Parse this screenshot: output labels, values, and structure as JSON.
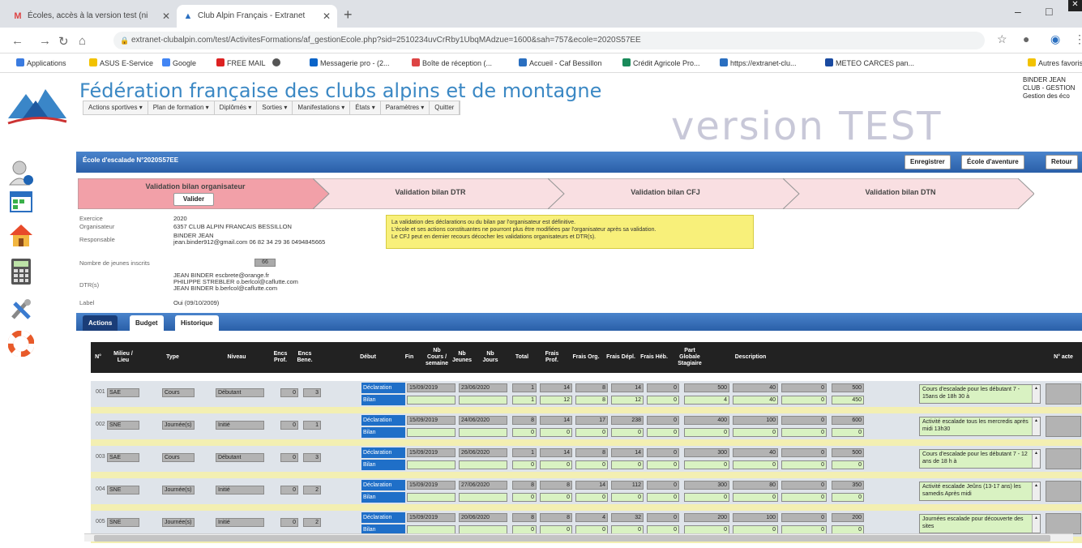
{
  "browser": {
    "tabs": [
      {
        "title": "Écoles, accès à la version test (ni",
        "icon": "gmail-icon"
      },
      {
        "title": "Club Alpin Français - Extranet",
        "icon": "caf-icon"
      }
    ],
    "url": "extranet-clubalpin.com/test/ActivitesFormations/af_gestionEcole.php?sid=2510234uvCrRby1UbqMAdzue=1600&sah=757&ecole=2020S57EE",
    "bookmarks": [
      "Applications",
      "ASUS E-Service",
      "Google",
      "FREE MAIL",
      "",
      "Messagerie pro - (2...",
      "Boîte de réception (...",
      "Accueil - Caf Bessillon",
      "Crédit Agricole Pro...",
      "https://extranet-clu...",
      "METEO CARCES pan..."
    ],
    "bookmarks_other": "Autres favoris"
  },
  "header": {
    "title": "Fédération française des clubs alpins et de montagne",
    "menu": [
      "Actions sportives ▾",
      "Plan de formation ▾",
      "Diplômés ▾",
      "Sorties ▾",
      "Manifestations ▾",
      "États ▾",
      "Paramètres ▾",
      "Quitter"
    ],
    "version": "version TEST",
    "user": [
      "BINDER JEAN",
      "CLUB - GESTION",
      "Gestion des éco"
    ]
  },
  "sidebar": [
    "user-icon",
    "calendar-icon",
    "home-icon",
    "calculator-icon",
    "tools-icon",
    "lifebuoy-icon"
  ],
  "panel": {
    "title": "École d'escalade N°2020S57EE",
    "buttons": [
      "Enregistrer",
      "École d'aventure",
      "Retour"
    ]
  },
  "steps": [
    {
      "label": "Validation bilan organisateur",
      "button": "Valider",
      "color": "#f2a0a8"
    },
    {
      "label": "Validation bilan DTR",
      "color": "#f9dfe2"
    },
    {
      "label": "Validation bilan CFJ",
      "color": "#f9dfe2"
    },
    {
      "label": "Validation bilan DTN",
      "color": "#f9dfe2"
    }
  ],
  "info": {
    "exercice_label": "Exercice",
    "exercice": "2020",
    "organisateur_label": "Organisateur",
    "organisateur": "6357 CLUB ALPIN FRANCAIS BESSILLON",
    "responsable_label": "Responsable",
    "responsable_name": "BINDER JEAN",
    "responsable_contact": "jean.binder912@gmail.com 06 82 34 29 36 0494845665",
    "nb_jeunes_label": "Nombre de jeunes inscrits",
    "nb_jeunes": "66",
    "dtr_label": "DTR(s)",
    "dtr": [
      "JEAN BINDER escbrete@orange.fr",
      "PHILIPPE STREBLER o.berlcol@caflutte.com",
      "JEAN BINDER b.berlcol@caflutte.com"
    ],
    "label_label": "Label",
    "label": "Oui (09/10/2009)"
  },
  "note": [
    "La validation des déclarations ou du bilan par l'organisateur est définitive.",
    "L'école et ses actions constituantes ne pourront plus être modifiées par l'organisateur après sa validation.",
    "Le CFJ peut en dernier recours décocher les validations organisateurs et DTR(s)."
  ],
  "tabs": [
    "Actions",
    "Budget",
    "Historique"
  ],
  "grid": {
    "headers": [
      "N°",
      "Milieu / Lieu",
      "Type",
      "Niveau",
      "Encs Prof.",
      "Encs Bene.",
      "Début",
      "Fin",
      "Nb Cours / semaine",
      "Nb Jeunes",
      "Nb Jours",
      "Total",
      "Frais Prof.",
      "Frais Org.",
      "Frais Dépl.",
      "Frais Héb.",
      "Part Globale Stagiaire",
      "Description",
      "N° acte"
    ],
    "row_labels": [
      "Déclaration",
      "Bilan"
    ],
    "rows": [
      {
        "num": "001",
        "milieu": "SAE",
        "type": "Cours",
        "niveau": "Débutant",
        "encp": "0",
        "encb": "3",
        "debut": "15/09/2019",
        "fin": "23/06/2020",
        "d": [
          "1",
          "14",
          "8",
          "14",
          "0",
          "500",
          "40",
          "0",
          "500"
        ],
        "b": [
          "1",
          "12",
          "8",
          "12",
          "0",
          "4",
          "40",
          "0",
          "450"
        ],
        "desc": "Cours d'escalade pour les débutant 7 - 15ans de 18h 30 à"
      },
      {
        "num": "002",
        "milieu": "SNE",
        "type": "Journée(s)",
        "niveau": "Initié",
        "encp": "0",
        "encb": "1",
        "debut": "15/09/2019",
        "fin": "24/06/2020",
        "d": [
          "8",
          "14",
          "17",
          "238",
          "0",
          "400",
          "100",
          "0",
          "600"
        ],
        "b": [
          "0",
          "0",
          "0",
          "0",
          "0",
          "0",
          "0",
          "0",
          "0"
        ],
        "desc": "Activité escalade tous les mercredis après midi 13h30"
      },
      {
        "num": "003",
        "milieu": "SAE",
        "type": "Cours",
        "niveau": "Débutant",
        "encp": "0",
        "encb": "3",
        "debut": "15/09/2019",
        "fin": "26/06/2020",
        "d": [
          "1",
          "14",
          "8",
          "14",
          "0",
          "300",
          "40",
          "0",
          "500"
        ],
        "b": [
          "0",
          "0",
          "0",
          "0",
          "0",
          "0",
          "0",
          "0",
          "0"
        ],
        "desc": "Cours d'escalade pour les débutant 7 - 12 ans de 18 h à"
      },
      {
        "num": "004",
        "milieu": "SNE",
        "type": "Journée(s)",
        "niveau": "Initié",
        "encp": "0",
        "encb": "2",
        "debut": "15/09/2019",
        "fin": "27/06/2020",
        "d": [
          "8",
          "8",
          "14",
          "112",
          "0",
          "300",
          "80",
          "0",
          "350"
        ],
        "b": [
          "0",
          "0",
          "0",
          "0",
          "0",
          "0",
          "0",
          "0",
          "0"
        ],
        "desc": "Activité escalade Jeûns (13-17 ans) les samedis Après midi"
      },
      {
        "num": "005",
        "milieu": "SNE",
        "type": "Journée(s)",
        "niveau": "Initié",
        "encp": "0",
        "encb": "2",
        "debut": "15/09/2019",
        "fin": "20/06/2020",
        "d": [
          "8",
          "8",
          "4",
          "32",
          "0",
          "200",
          "100",
          "0",
          "200"
        ],
        "b": [
          "0",
          "0",
          "0",
          "0",
          "0",
          "0",
          "0",
          "0",
          "0"
        ],
        "desc": "Journées escalade pour découverte des sites"
      }
    ]
  }
}
